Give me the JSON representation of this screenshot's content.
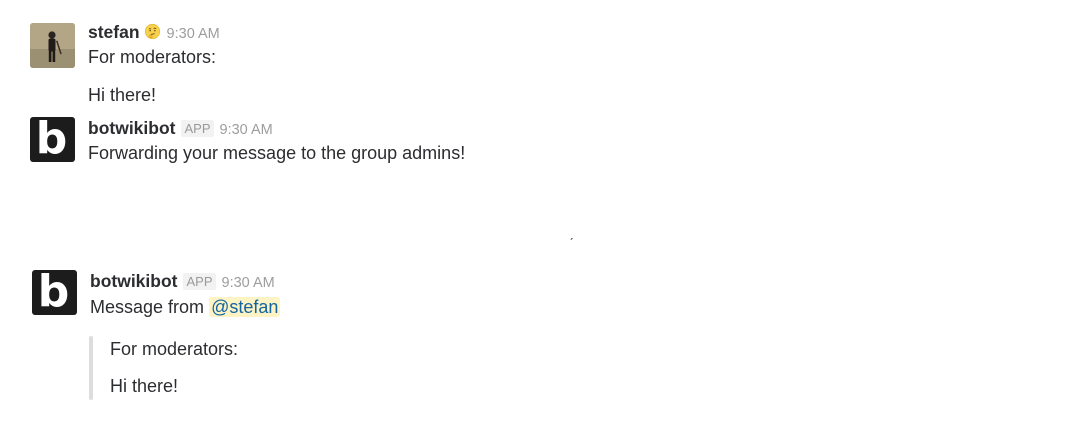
{
  "messages": [
    {
      "user": "stefan",
      "status_emoji": "thinking-face-icon",
      "time": "9:30 AM",
      "lines": [
        "For moderators:",
        "Hi there!"
      ]
    },
    {
      "user": "botwikibot",
      "badge": "APP",
      "avatar_letter": "b",
      "time": "9:30 AM",
      "lines": [
        "Forwarding your message to the group admins!"
      ]
    },
    {
      "user": "botwikibot",
      "badge": "APP",
      "avatar_letter": "b",
      "time": "9:30 AM",
      "text_prefix": "Message from",
      "mention": "@stefan",
      "quote_lines": [
        "For moderators:",
        "Hi there!"
      ]
    }
  ],
  "stray_mark": "ˏ",
  "colors": {
    "mention_bg": "#fdf3c4",
    "mention_text": "#1264a3",
    "quote_bar": "#dddddd",
    "timestamp": "#9d9d9e"
  }
}
